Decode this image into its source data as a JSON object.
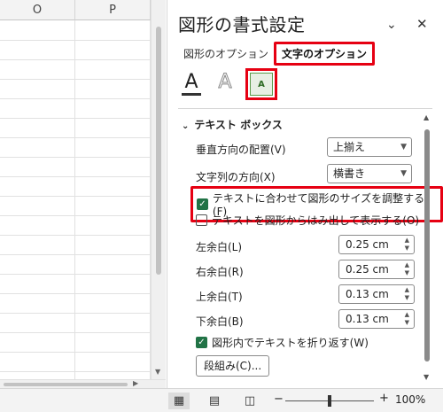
{
  "sheet": {
    "columns": [
      "O",
      "P"
    ]
  },
  "pane": {
    "title": "図形の書式設定",
    "tabs": [
      "図形のオプション",
      "文字のオプション"
    ],
    "icons": [
      "text-fill-icon",
      "text-outline-icon",
      "textbox-icon"
    ],
    "textbox_icon_glyph": "A",
    "section": "テキスト ボックス",
    "vertical_align_label": "垂直方向の配置(V)",
    "vertical_align_value": "上揃え",
    "text_direction_label": "文字列の方向(X)",
    "text_direction_value": "横書き",
    "autofit_label": "テキストに合わせて図形のサイズを調整する(F)",
    "autofit_checked": true,
    "overflow_label": "テキストを図形からはみ出して表示する(O)",
    "overflow_checked": false,
    "margins": [
      {
        "label": "左余白(L)",
        "value": "0.25 cm"
      },
      {
        "label": "右余白(R)",
        "value": "0.25 cm"
      },
      {
        "label": "上余白(T)",
        "value": "0.13 cm"
      },
      {
        "label": "下余白(B)",
        "value": "0.13 cm"
      }
    ],
    "wrap_label": "図形内でテキストを折り返す(W)",
    "wrap_checked": true,
    "columns_button": "段組み(C)..."
  },
  "status": {
    "zoom": "100%"
  },
  "colors": {
    "highlight": "#e60012",
    "excel_green": "#217346"
  }
}
